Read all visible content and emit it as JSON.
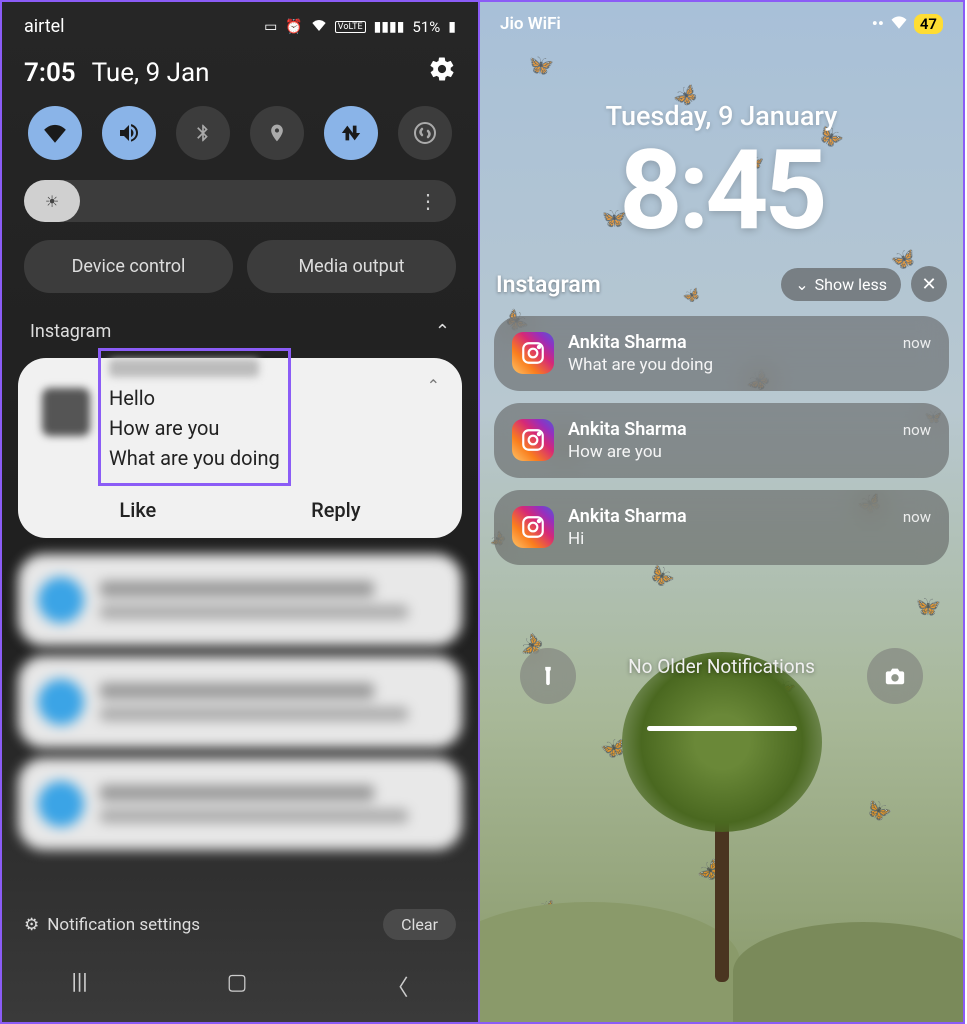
{
  "android": {
    "status": {
      "carrier": "airtel",
      "battery": "51%"
    },
    "datetime": {
      "time": "7:05",
      "date": "Tue, 9 Jan"
    },
    "quick_buttons": {
      "device_control": "Device control",
      "media_output": "Media output"
    },
    "notif_app": "Instagram",
    "messages": {
      "l1": "Hello",
      "l2": "How are you",
      "l3": "What are you doing"
    },
    "actions": {
      "like": "Like",
      "reply": "Reply"
    },
    "footer": {
      "settings": "Notification settings",
      "clear": "Clear"
    }
  },
  "ios": {
    "status": {
      "carrier": "Jio WiFi",
      "battery": "47"
    },
    "date": "Tuesday, 9 January",
    "time": "8:45",
    "group": {
      "title": "Instagram",
      "show_less": "Show less"
    },
    "notifs": [
      {
        "sender": "Ankita Sharma",
        "msg": "What are you doing",
        "ts": "now"
      },
      {
        "sender": "Ankita Sharma",
        "msg": "How are you",
        "ts": "now"
      },
      {
        "sender": "Ankita Sharma",
        "msg": "Hi",
        "ts": "now"
      }
    ],
    "older": "No Older Notifications"
  }
}
